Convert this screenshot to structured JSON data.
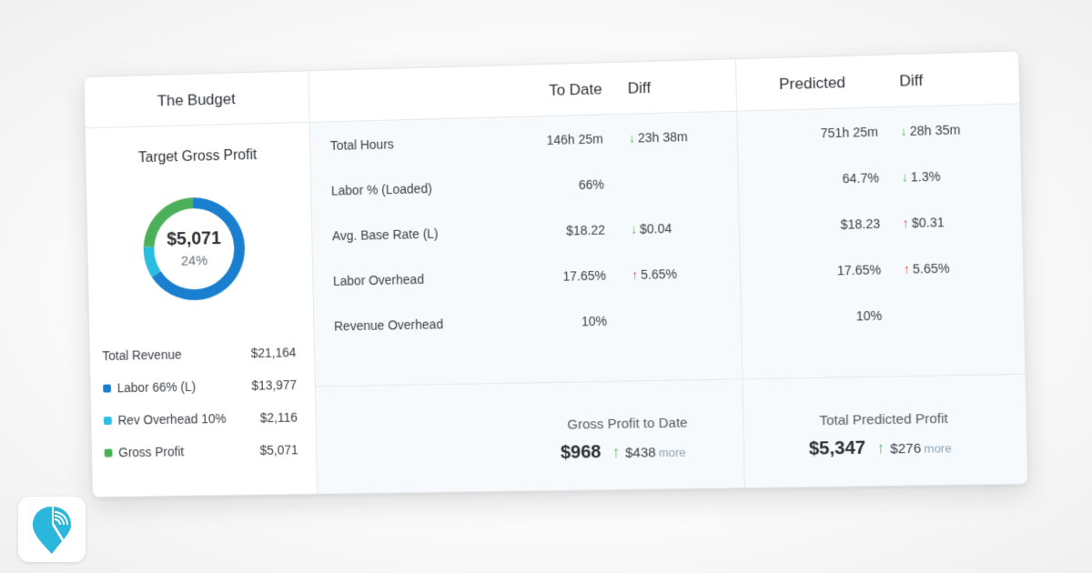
{
  "budget": {
    "header": "The Budget",
    "chart_title": "Target Gross Profit",
    "donut_amount": "$5,071",
    "donut_percent": "24%",
    "total_revenue_label": "Total Revenue",
    "total_revenue_value": "$21,164",
    "legend": [
      {
        "label": "Labor 66% (L)",
        "value": "$13,977",
        "color": "#1a7fcf"
      },
      {
        "label": "Rev Overhead 10%",
        "value": "$2,116",
        "color": "#2bbde0"
      },
      {
        "label": "Gross Profit",
        "value": "$5,071",
        "color": "#4cb05a"
      }
    ]
  },
  "chart_data": {
    "type": "pie",
    "title": "Target Gross Profit",
    "categories": [
      "Labor 66% (L)",
      "Rev Overhead 10%",
      "Gross Profit"
    ],
    "values": [
      13977,
      2116,
      5071
    ],
    "colors": [
      "#1a7fcf",
      "#2bbde0",
      "#4cb05a"
    ],
    "center_label": "$5,071",
    "center_sublabel": "24%"
  },
  "to_date": {
    "col_value": "To Date",
    "col_diff": "Diff",
    "rows": [
      {
        "label": "Total Hours",
        "value": "146h 25m",
        "diff": "23h 38m",
        "dir": "down"
      },
      {
        "label": "Labor % (Loaded)",
        "value": "66%",
        "diff": "",
        "dir": ""
      },
      {
        "label": "Avg. Base Rate (L)",
        "value": "$18.22",
        "diff": "$0.04",
        "dir": "down"
      },
      {
        "label": "Labor Overhead",
        "value": "17.65%",
        "diff": "5.65%",
        "dir": "up"
      },
      {
        "label": "Revenue Overhead",
        "value": "10%",
        "diff": "",
        "dir": ""
      }
    ],
    "footer": {
      "title": "Gross Profit to Date",
      "amount": "$968",
      "diff": "$438",
      "more": "more"
    }
  },
  "predicted": {
    "col_value": "Predicted",
    "col_diff": "Diff",
    "rows": [
      {
        "value": "751h 25m",
        "diff": "28h 35m",
        "dir": "down"
      },
      {
        "value": "64.7%",
        "diff": "1.3%",
        "dir": "down"
      },
      {
        "value": "$18.23",
        "diff": "$0.31",
        "dir": "up"
      },
      {
        "value": "17.65%",
        "diff": "5.65%",
        "dir": "up"
      },
      {
        "value": "10%",
        "diff": "",
        "dir": ""
      }
    ],
    "footer": {
      "title": "Total Predicted Profit",
      "amount": "$5,347",
      "diff": "$276",
      "more": "more"
    }
  },
  "arrows": {
    "up": "↑",
    "down": "↓"
  },
  "app_icon": "location-pin-signal-icon"
}
